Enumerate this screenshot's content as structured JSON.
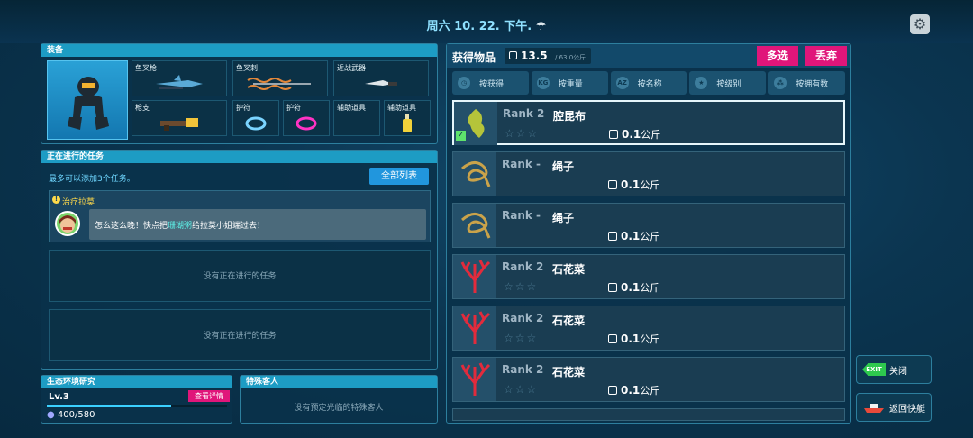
{
  "header": {
    "datetime": "周六 10. 22. 下午."
  },
  "equipment": {
    "title": "装备",
    "slots": {
      "speargun": "鱼叉枪",
      "spear": "鱼叉刺",
      "melee": "近战武器",
      "gun": "枪支",
      "charm1": "护符",
      "charm2": "护符",
      "aux1": "辅助道具",
      "aux2": "辅助道具"
    }
  },
  "tasks": {
    "title": "正在进行的任务",
    "hint": "最多可以添加3个任务。",
    "all_list_label": "全部列表",
    "active_task": {
      "name": "治疗拉莫",
      "message_pre": "怎么这么晚！快点把",
      "message_highlight": "珊瑚粥",
      "message_post": "给拉莫小姐端过去！"
    },
    "empty_label_1": "没有正在进行的任务",
    "empty_label_2": "没有正在进行的任务"
  },
  "research": {
    "title": "生态环境研究",
    "level": "Lv.3",
    "details_label": "查看详情",
    "exp": "400/580",
    "exp_fraction": 0.69
  },
  "guest": {
    "title": "特殊客人",
    "empty_label": "没有预定光临的特殊客人"
  },
  "items": {
    "title": "获得物品",
    "weight": "13.5",
    "weight_max": "/ 63.0公斤",
    "multi_select_label": "多选",
    "discard_label": "丢弃",
    "sort_tabs": [
      "按获得",
      "按重量",
      "按名称",
      "按级别",
      "按拥有数"
    ],
    "list": [
      {
        "rank": "Rank 2",
        "name": "腔昆布",
        "weight": "0.1",
        "unit": "公斤"
      },
      {
        "rank": "Rank -",
        "name": "绳子",
        "weight": "0.1",
        "unit": "公斤"
      },
      {
        "rank": "Rank -",
        "name": "绳子",
        "weight": "0.1",
        "unit": "公斤"
      },
      {
        "rank": "Rank 2",
        "name": "石花菜",
        "weight": "0.1",
        "unit": "公斤"
      },
      {
        "rank": "Rank 2",
        "name": "石花菜",
        "weight": "0.1",
        "unit": "公斤"
      },
      {
        "rank": "Rank 2",
        "name": "石花菜",
        "weight": "0.1",
        "unit": "公斤"
      }
    ]
  },
  "side_buttons": {
    "close_label": "关闭",
    "exit_badge": "EXIT",
    "return_label": "返回快艇"
  },
  "colors": {
    "accent_pink": "#e0167a",
    "panel_cyan": "#1d9cc4",
    "highlight": "#5df0e7"
  }
}
